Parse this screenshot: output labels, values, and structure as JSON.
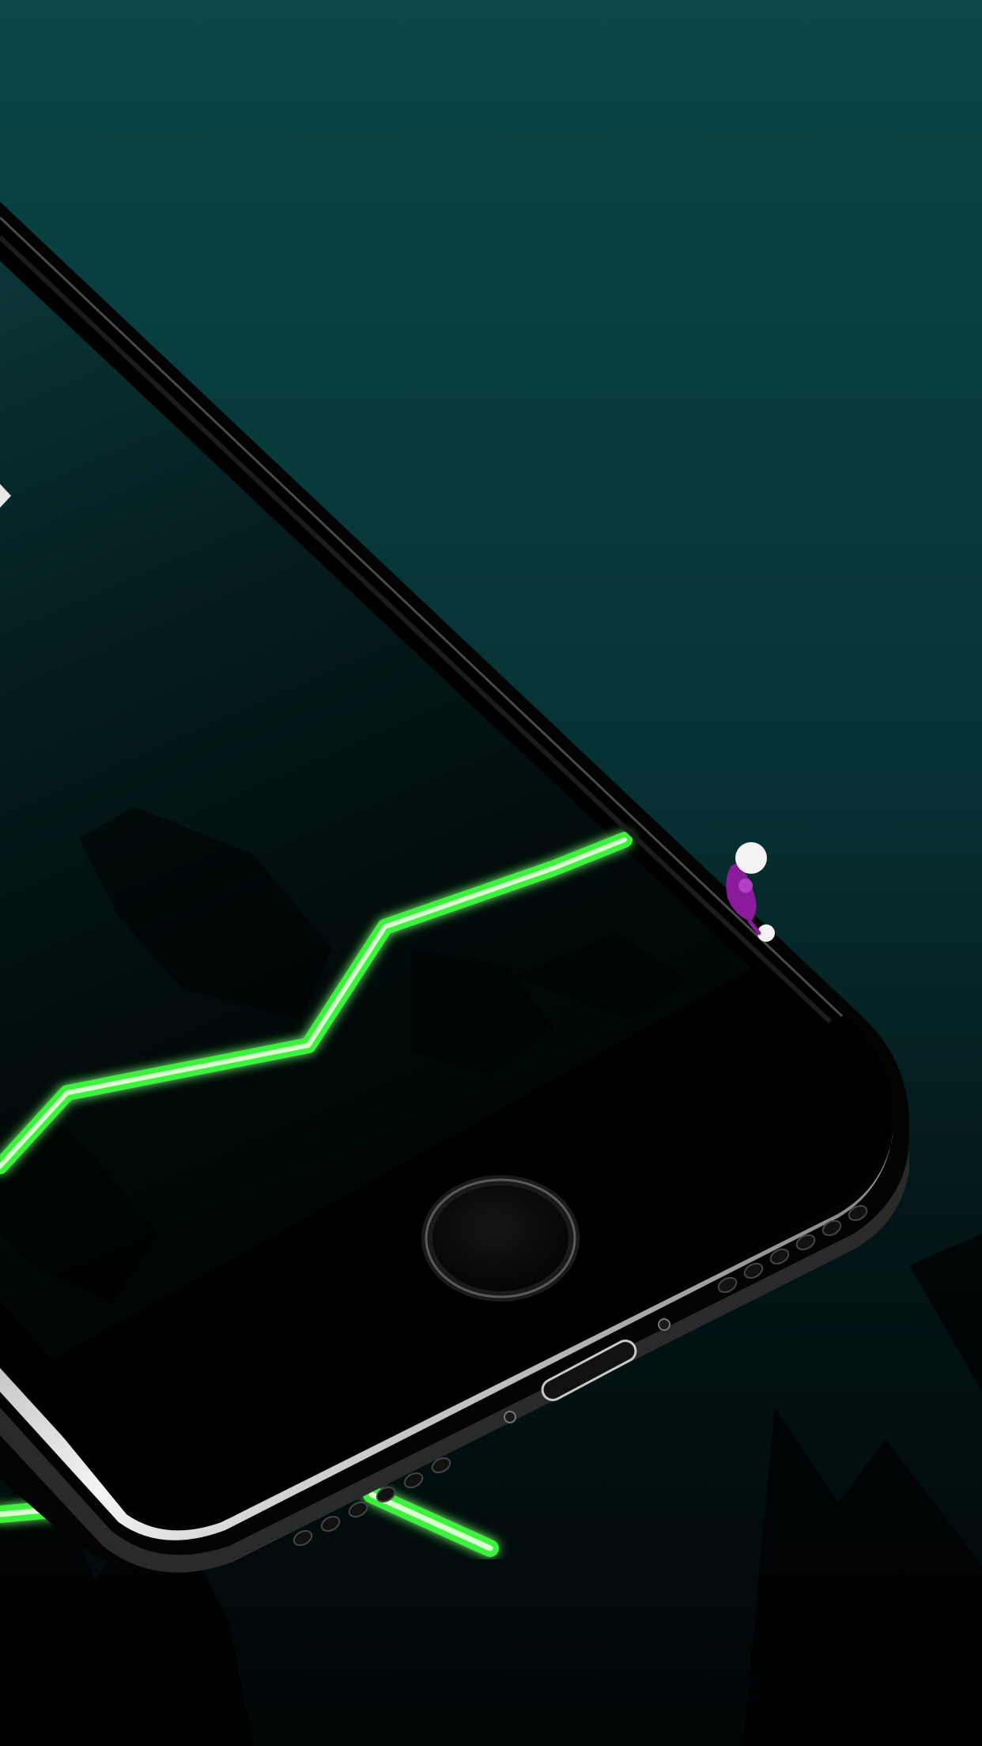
{
  "scene": {
    "description_visible_text": [],
    "colors": {
      "background_top": "#0b4648",
      "background_mid": "#062c2e",
      "background_bottom": "#010708",
      "track_neon": "#3cf23c",
      "track_core": "#d9ffd0",
      "device_body": "#050505",
      "device_chrome": "#e6e6e6",
      "rider_body": "#8b1a9c",
      "rider_helmet": "#f2f2f2"
    },
    "icons": {
      "device": "phone-device-icon",
      "home_button": "home-button-icon",
      "rider": "rider-character-icon",
      "speaker": "speaker-grille-icon",
      "port": "charging-port-icon"
    }
  }
}
